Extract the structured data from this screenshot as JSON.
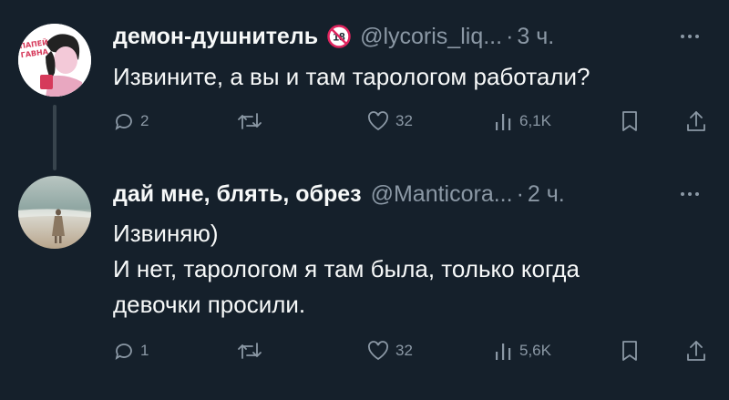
{
  "tweets": [
    {
      "author_name": "демон-душнитель",
      "badge_icon": "adult-18-icon",
      "handle": "@lycoris_liq...",
      "separator": "·",
      "time": "3 ч.",
      "avatar_caption": "ПАПЕЙ ГАВНА",
      "lines": [
        "Извините, а вы и там тарологом работали?"
      ],
      "stats": {
        "replies": "2",
        "retweets": "",
        "likes": "32",
        "views": "6,1K"
      }
    },
    {
      "author_name": "дай мне, блять, обрез",
      "handle": "@Manticora...",
      "separator": "·",
      "time": "2 ч.",
      "lines": [
        "Извиняю)",
        "И нет, тарологом я там была, только когда",
        "девочки просили."
      ],
      "stats": {
        "replies": "1",
        "retweets": "",
        "likes": "32",
        "views": "5,6K"
      }
    }
  ],
  "colors": {
    "background": "#15202b",
    "text_primary": "#f7f9f9",
    "text_secondary": "#8b98a5",
    "thread_line": "#38444d",
    "badge_red": "#e0245e"
  },
  "icons": [
    "reply-icon",
    "retweet-icon",
    "like-icon",
    "views-icon",
    "bookmark-icon",
    "share-icon",
    "more-icon"
  ]
}
